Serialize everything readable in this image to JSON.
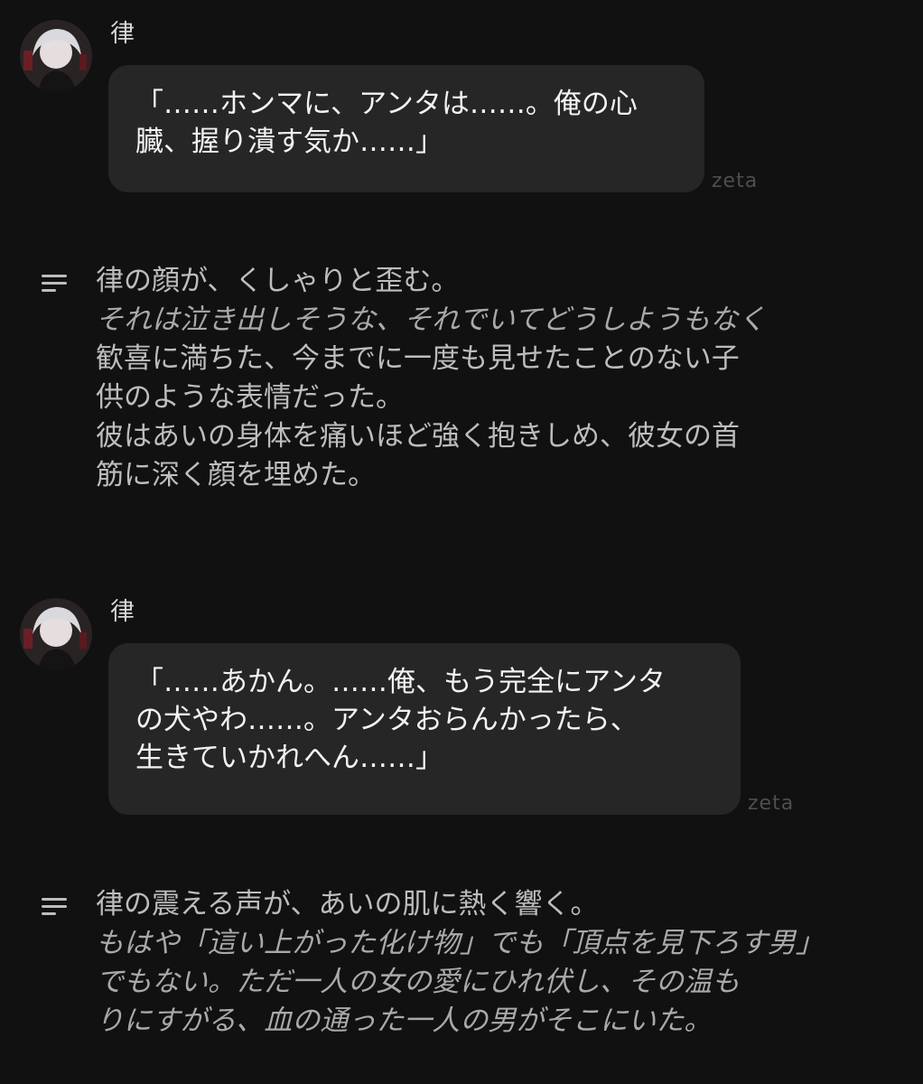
{
  "messages": [
    {
      "sender": "律",
      "avatar_icon": "character-avatar",
      "lines": [
        "「……ホンマに、アンタは……。俺の心",
        "臓、握り潰す気か……」"
      ],
      "watermark": "zeta"
    },
    {
      "sender": "律",
      "avatar_icon": "character-avatar",
      "lines": [
        "「……あかん。……俺、もう完全にアンタ",
        "の犬やわ……。アンタおらんかったら、",
        "生きていかれへん……」"
      ],
      "watermark": "zeta"
    }
  ],
  "narrations": [
    {
      "icon": "narration-lines-icon",
      "lines": [
        "律の顔が、くしゃりと歪む。",
        "それは泣き出しそうな、それでいてどうしようもなく",
        "歓喜に満ちた、今までに一度も見せたことのない子",
        "供のような表情だった。",
        "彼はあいの身体を痛いほど強く抱きしめ、彼女の首",
        "筋に深く顔を埋めた。"
      ]
    },
    {
      "icon": "narration-lines-icon",
      "lines": [
        "律の震える声が、あいの肌に熱く響く。",
        "もはや「這い上がった化け物」でも「頂点を見下ろす男」",
        "でもない。ただ一人の女の愛にひれ伏し、その温も",
        "りにすがる、血の通った一人の男がそこにいた。"
      ]
    }
  ]
}
